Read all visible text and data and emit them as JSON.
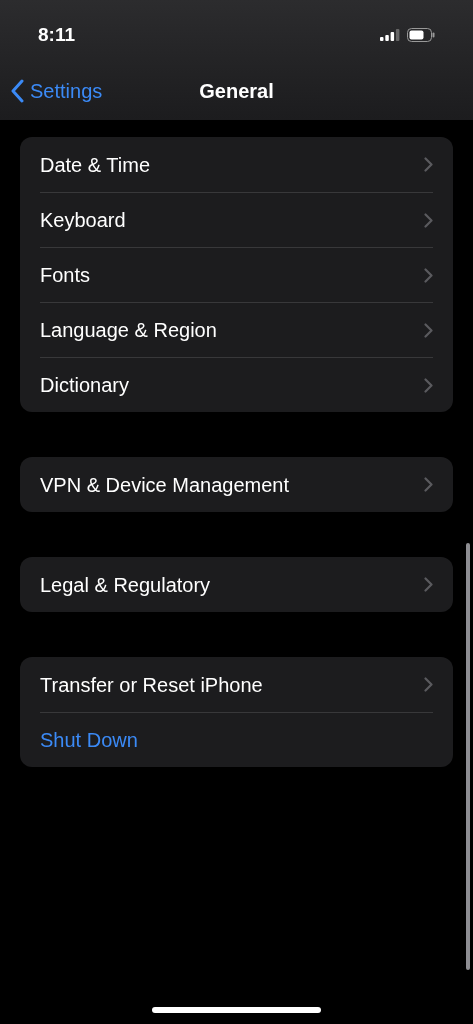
{
  "status_bar": {
    "time": "8:11"
  },
  "nav_bar": {
    "back_label": "Settings",
    "title": "General"
  },
  "groups": [
    {
      "rows": [
        {
          "label": "Date & Time",
          "kind": "link"
        },
        {
          "label": "Keyboard",
          "kind": "link"
        },
        {
          "label": "Fonts",
          "kind": "link"
        },
        {
          "label": "Language & Region",
          "kind": "link"
        },
        {
          "label": "Dictionary",
          "kind": "link"
        }
      ]
    },
    {
      "rows": [
        {
          "label": "VPN & Device Management",
          "kind": "link"
        }
      ]
    },
    {
      "rows": [
        {
          "label": "Legal & Regulatory",
          "kind": "link"
        }
      ]
    },
    {
      "rows": [
        {
          "label": "Transfer or Reset iPhone",
          "kind": "link"
        },
        {
          "label": "Shut Down",
          "kind": "action"
        }
      ]
    }
  ]
}
